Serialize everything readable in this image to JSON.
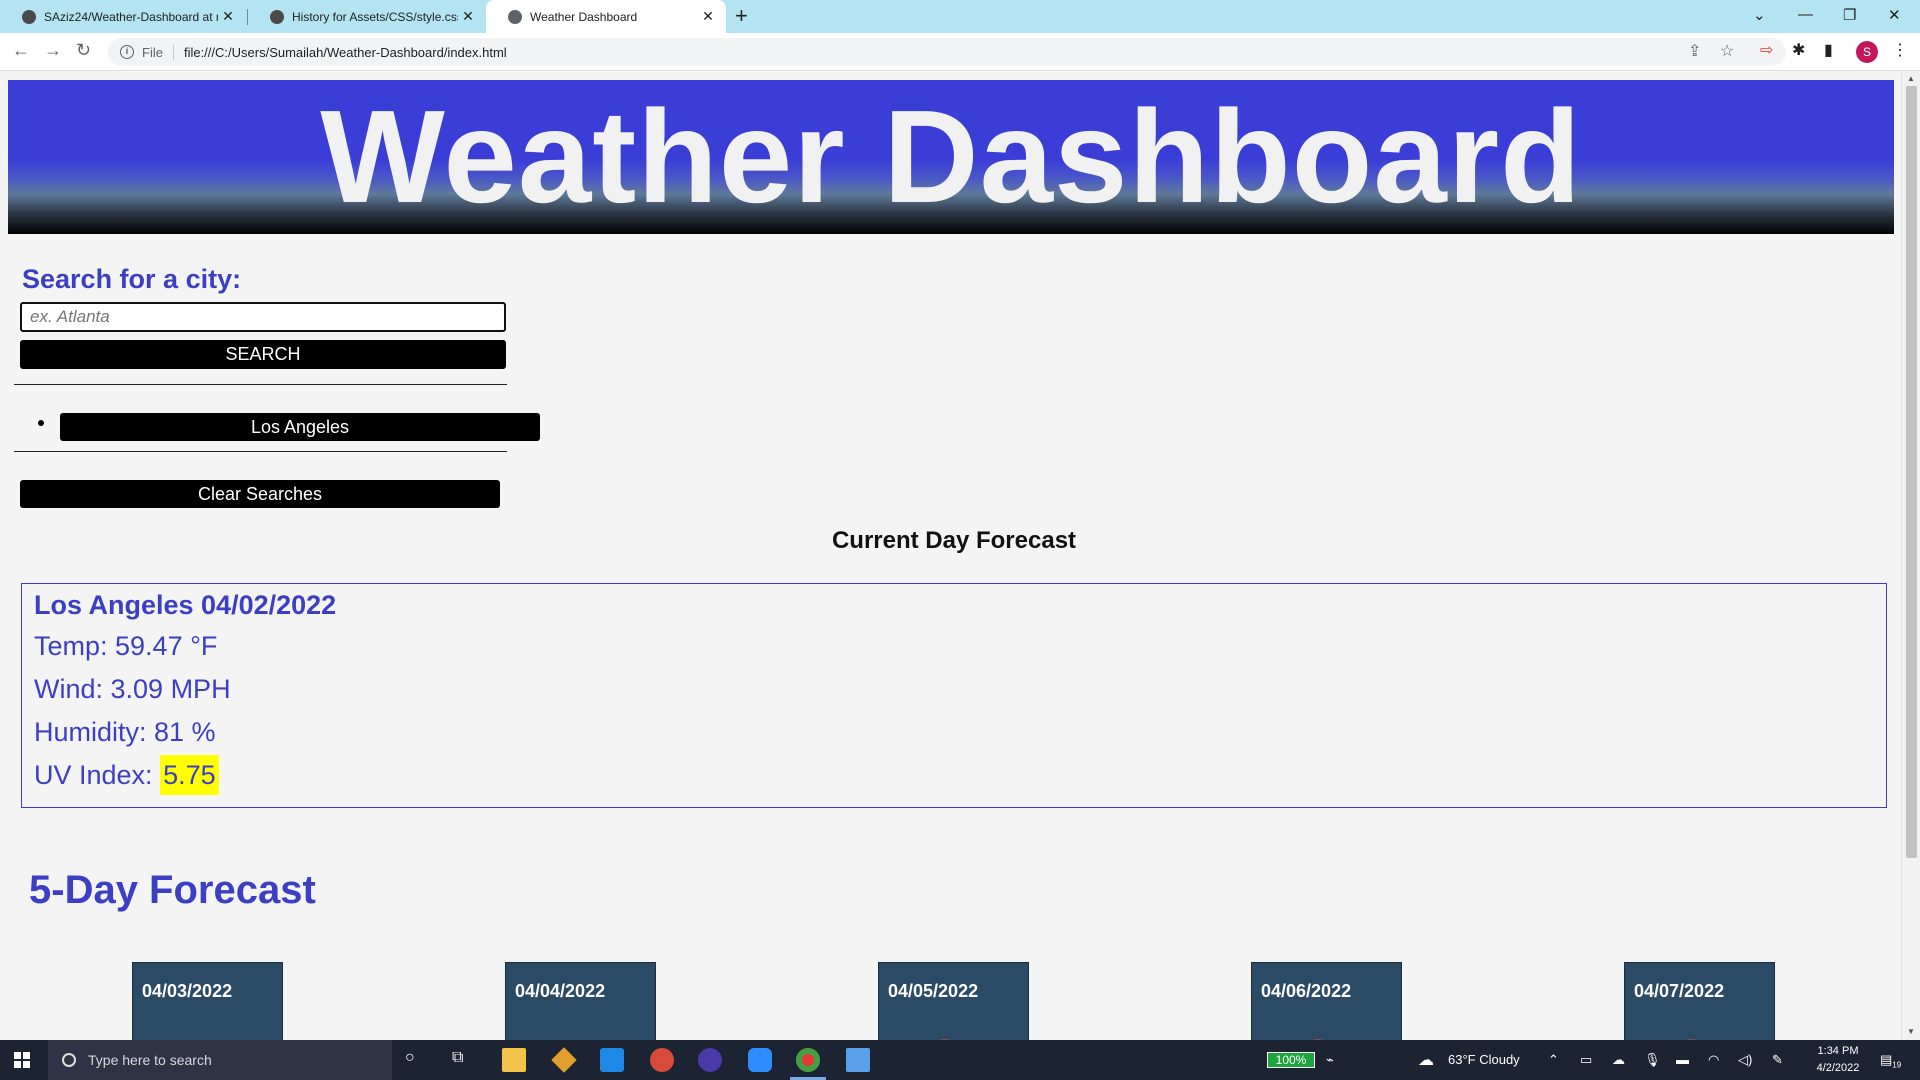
{
  "browser": {
    "tabs": [
      {
        "title": "SAziz24/Weather-Dashboard at m",
        "active": false
      },
      {
        "title": "History for Assets/CSS/style.css · ",
        "active": false
      },
      {
        "title": "Weather Dashboard",
        "active": true
      }
    ],
    "new_tab_label": "+",
    "scheme_label": "File",
    "url": "file:///C:/Users/Sumailah/Weather-Dashboard/index.html",
    "profile_initial": "S"
  },
  "page": {
    "title": "Weather Dashboard",
    "search": {
      "label": "Search for a city:",
      "placeholder": "ex. Atlanta",
      "value": "",
      "button_label": "SEARCH"
    },
    "history": [
      "Los Angeles"
    ],
    "clear_label": "Clear Searches",
    "current": {
      "heading": "Current Day Forecast",
      "city_date": "Los Angeles 04/02/2022",
      "temp": "Temp: 59.47 °F",
      "wind": "Wind: 3.09 MPH",
      "humidity": "Humidity: 81 %",
      "uv_label": "UV Index: ",
      "uv_value": "5.75"
    },
    "five_day": {
      "heading": "5-Day Forecast",
      "dates": [
        "04/03/2022",
        "04/04/2022",
        "04/05/2022",
        "04/06/2022",
        "04/07/2022"
      ]
    }
  },
  "taskbar": {
    "search_placeholder": "Type here to search",
    "battery": "100%",
    "weather": "63°F  Cloudy",
    "time": "1:34 PM",
    "date": "4/2/2022",
    "notifications": "19"
  },
  "colors": {
    "accent": "#3c3fc4",
    "hero_blue": "#3a3ed6",
    "card_bg": "#2a4a66",
    "uv_highlight": "#ffff00"
  }
}
